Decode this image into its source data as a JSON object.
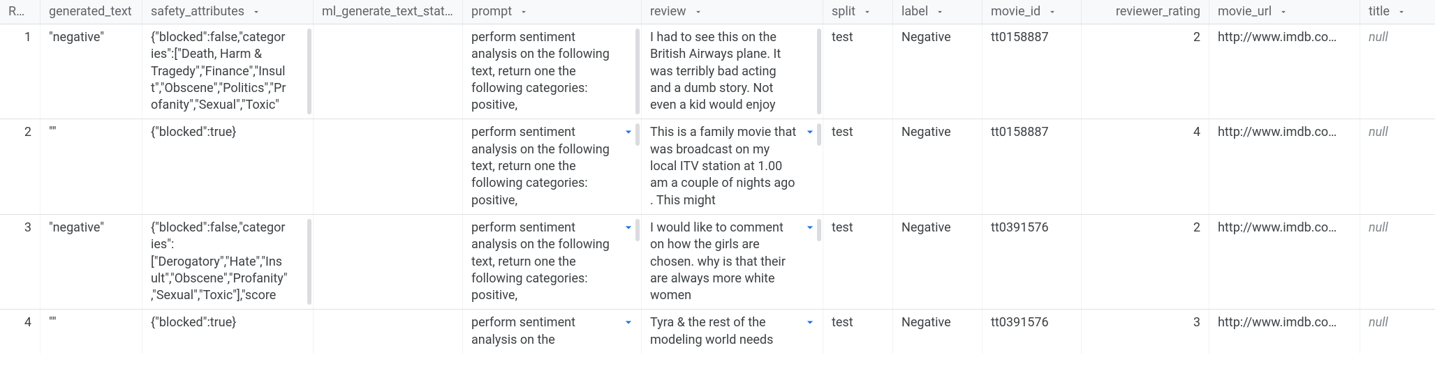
{
  "columns": {
    "row": "Row",
    "generated_text": "generated_text",
    "safety_attributes": "safety_attributes",
    "ml_generate_text_status": "ml_generate_text_status",
    "prompt": "prompt",
    "review": "review",
    "split": "split",
    "label": "label",
    "movie_id": "movie_id",
    "reviewer_rating": "reviewer_rating",
    "movie_url": "movie_url",
    "title": "title"
  },
  "rows": [
    {
      "row": "1",
      "generated_text": "\"negative\"",
      "safety_attributes": "{\"blocked\":false,\"categories\":[\"Death, Harm & Tragedy\",\"Finance\",\"Insult\",\"Obscene\",\"Politics\",\"Profanity\",\"Sexual\",\"Toxic\"",
      "ml_generate_text_status": "",
      "prompt": "perform sentiment analysis on the following text, return one the following categories: positive,",
      "review": "I had to see this on the British Airways plane. It was terribly bad acting and a dumb story. Not even a kid would enjoy",
      "split": "test",
      "label": "Negative",
      "movie_id": "tt0158887",
      "reviewer_rating": "2",
      "movie_url": "http://www.imdb.co…",
      "title": "null"
    },
    {
      "row": "2",
      "generated_text": "\"\"",
      "safety_attributes": "{\"blocked\":true}",
      "ml_generate_text_status": "",
      "prompt": "perform sentiment analysis on the following text, return one the following categories: positive,",
      "review": "This is a family movie that was broadcast on my local ITV station at 1.00 am a couple of nights ago . This might",
      "split": "test",
      "label": "Negative",
      "movie_id": "tt0158887",
      "reviewer_rating": "4",
      "movie_url": "http://www.imdb.co…",
      "title": "null"
    },
    {
      "row": "3",
      "generated_text": "\"negative\"",
      "safety_attributes": "{\"blocked\":false,\"categories\":[\"Derogatory\",\"Hate\",\"Insult\",\"Obscene\",\"Profanity\",\"Sexual\",\"Toxic\"],\"score",
      "ml_generate_text_status": "",
      "prompt": "perform sentiment analysis on the following text, return one the following categories: positive,",
      "review": "I would like to comment on how the girls are chosen. why is that their are always more white women",
      "split": "test",
      "label": "Negative",
      "movie_id": "tt0391576",
      "reviewer_rating": "2",
      "movie_url": "http://www.imdb.co…",
      "title": "null"
    },
    {
      "row": "4",
      "generated_text": "\"\"",
      "safety_attributes": "{\"blocked\":true}",
      "ml_generate_text_status": "",
      "prompt": "perform sentiment analysis on the",
      "review": "Tyra & the rest of the modeling world needs",
      "split": "test",
      "label": "Negative",
      "movie_id": "tt0391576",
      "reviewer_rating": "3",
      "movie_url": "http://www.imdb.co…",
      "title": "null"
    }
  ]
}
